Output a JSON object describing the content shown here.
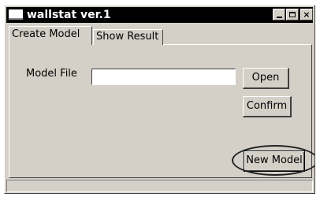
{
  "window": {
    "title": "wallstat ver.1"
  },
  "tabs": [
    {
      "label": "Create Model",
      "selected": true
    },
    {
      "label": "Show Result",
      "selected": false
    }
  ],
  "form": {
    "model_file_label": "Model File",
    "model_file_value": "",
    "model_file_placeholder": ""
  },
  "buttons": {
    "open": "Open",
    "confirm": "Confirm",
    "new_model": "New Model"
  },
  "statusbar": {
    "text": ""
  }
}
